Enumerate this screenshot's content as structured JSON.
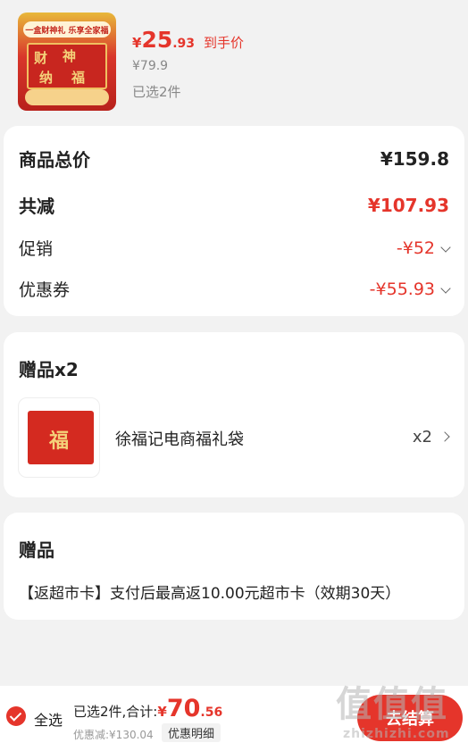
{
  "product": {
    "image_banner": "一盒财神礼 乐享全家福",
    "image_chars": [
      "财",
      "神",
      "纳",
      "福"
    ],
    "price_currency": "¥",
    "price_int": "25",
    "price_dec": ".93",
    "price_tag": "到手价",
    "original_price": "¥79.9",
    "selected_count": "已选2件"
  },
  "summary": {
    "total_label": "商品总价",
    "total_value": "¥159.8",
    "discount_label": "共减",
    "discount_value": "¥107.93",
    "promo_label": "促销",
    "promo_value": "-¥52",
    "coupon_label": "优惠券",
    "coupon_value": "-¥55.93"
  },
  "gifts": {
    "title": "赠品x2",
    "item_image_char": "福",
    "item_name": "徐福记电商福礼袋",
    "item_qty": "x2"
  },
  "bonus": {
    "title": "赠品",
    "text": "【返超市卡】支付后最高返10.00元超市卡（效期30天）"
  },
  "footer": {
    "select_all": "全选",
    "sum_label": "已选2件,合计:",
    "sum_currency": "¥",
    "sum_int": "70",
    "sum_dec": ".56",
    "discount_text": "优惠减:¥130.04",
    "detail_button": "优惠明细",
    "checkout_button": "去结算"
  },
  "watermark": {
    "big": "值值值",
    "small": "zhizhizhi.com"
  },
  "colors": {
    "accent": "#e5352b",
    "background": "#f2f2f2"
  }
}
